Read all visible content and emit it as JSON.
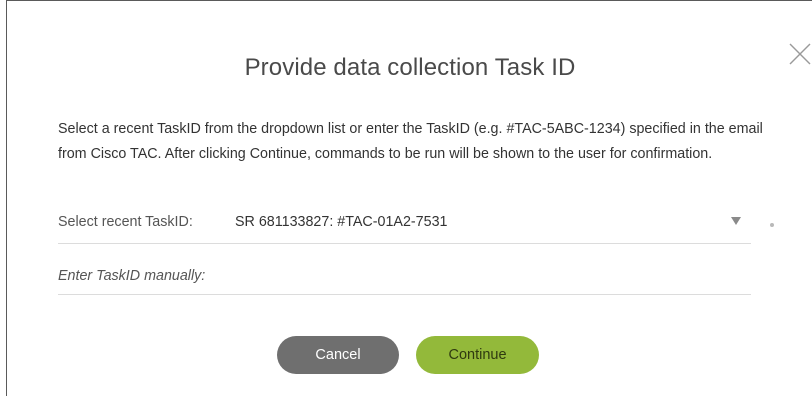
{
  "dialog": {
    "title": "Provide data collection Task ID",
    "description": "Select a recent TaskID from the dropdown list or enter the TaskID (e.g. #TAC-5ABC-1234) specified in the email from Cisco TAC. After clicking Continue, commands to be run will be shown to the user for confirmation.",
    "close_icon": "close-icon",
    "select": {
      "label": "Select recent TaskID:",
      "value": "SR 681133827: #TAC-01A2-7531",
      "caret_icon": "caret-down-icon"
    },
    "manual": {
      "placeholder": "Enter TaskID manually:",
      "value": ""
    },
    "buttons": {
      "cancel_label": "Cancel",
      "continue_label": "Continue"
    },
    "colors": {
      "cancel": "#6f6f6f",
      "continue": "#93b93a",
      "title_text": "#4a4a4a"
    }
  }
}
